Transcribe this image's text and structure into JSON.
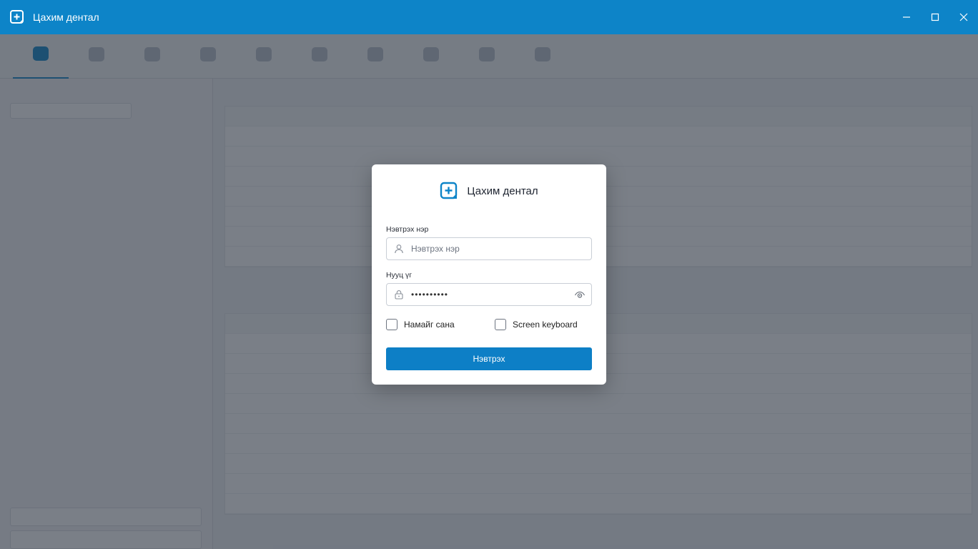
{
  "window": {
    "title": "Цахим дентал",
    "controls": {
      "minimize": "—",
      "maximize": "☐",
      "close": "✕"
    }
  },
  "dialog": {
    "brand": "Цахим дентал",
    "username": {
      "label": "Нэвтрэх нэр",
      "placeholder": "Нэвтрэх нэр",
      "value": ""
    },
    "password": {
      "label": "Нууц үг",
      "value": "••••••••••"
    },
    "remember_me": {
      "label": "Намайг сана",
      "checked": false
    },
    "screen_keyboard": {
      "label": "Screen keyboard",
      "checked": false
    },
    "login_button": "Нэвтрэх"
  },
  "colors": {
    "accent": "#0d84c8",
    "button": "#0d7fc6",
    "overlay": "rgba(40,48,62,0.62)"
  }
}
